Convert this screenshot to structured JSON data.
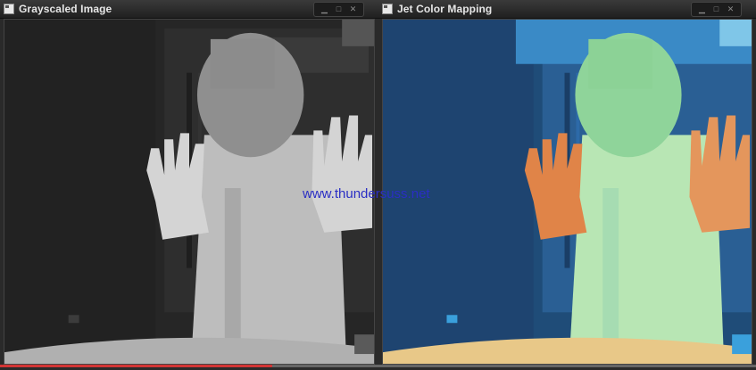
{
  "windows": {
    "left": {
      "title": "Grayscaled Image"
    },
    "right": {
      "title": "Jet Color Mapping"
    }
  },
  "window_controls": [
    "minimize-icon",
    "maximize-icon",
    "close-icon"
  ],
  "watermark": {
    "text": "www.thundersuss.net",
    "color": "#2a2ec4"
  },
  "video": {
    "progress": 0.36,
    "played_color": "#d23434"
  },
  "colors": {
    "gray_background": "#262626",
    "gray_body": "#bdbdbd",
    "gray_hands": "#d4d4d4",
    "jet_background": "#1f4c78",
    "jet_body": "#b8e6b4",
    "jet_hands": "#e08448",
    "jet_floor": "#e8c888"
  }
}
